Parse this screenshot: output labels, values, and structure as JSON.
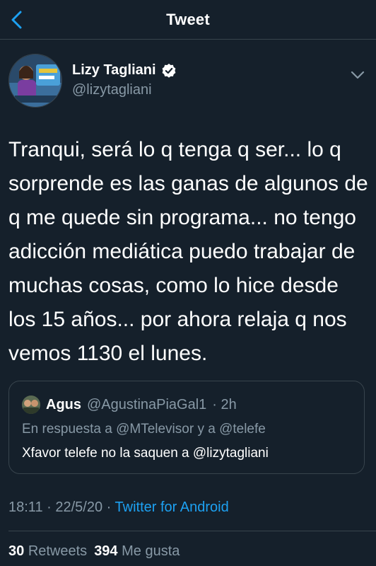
{
  "header": {
    "title": "Tweet",
    "back_icon": "chevron-left-icon",
    "accent_color": "#1da1f2"
  },
  "author": {
    "display_name": "Lizy Tagliani",
    "handle": "@lizytagliani",
    "verified": true,
    "menu_icon": "chevron-down-icon"
  },
  "tweet": {
    "text": "Tranqui, será lo q tenga q ser... lo q sorprende es las ganas de algunos de q me quede sin programa... no tengo adicción mediática puedo trabajar de muchas cosas, como lo hice desde los 15 años... por ahora relaja q nos vemos 1130 el lunes."
  },
  "quoted_tweet": {
    "name": "Agus",
    "handle": "@AgustinaPiaGal1",
    "time": "· 2h",
    "reply_to": "En respuesta a @MTelevisor y a @telefe",
    "text": "Xfavor telefe no la saquen a @lizytagliani"
  },
  "meta": {
    "time": "18:11",
    "date": "· 22/5/20 ·",
    "source": "Twitter for Android"
  },
  "stats": {
    "retweets_count": "30",
    "retweets_label": "Retweets",
    "likes_count": "394",
    "likes_label": "Me gusta"
  }
}
